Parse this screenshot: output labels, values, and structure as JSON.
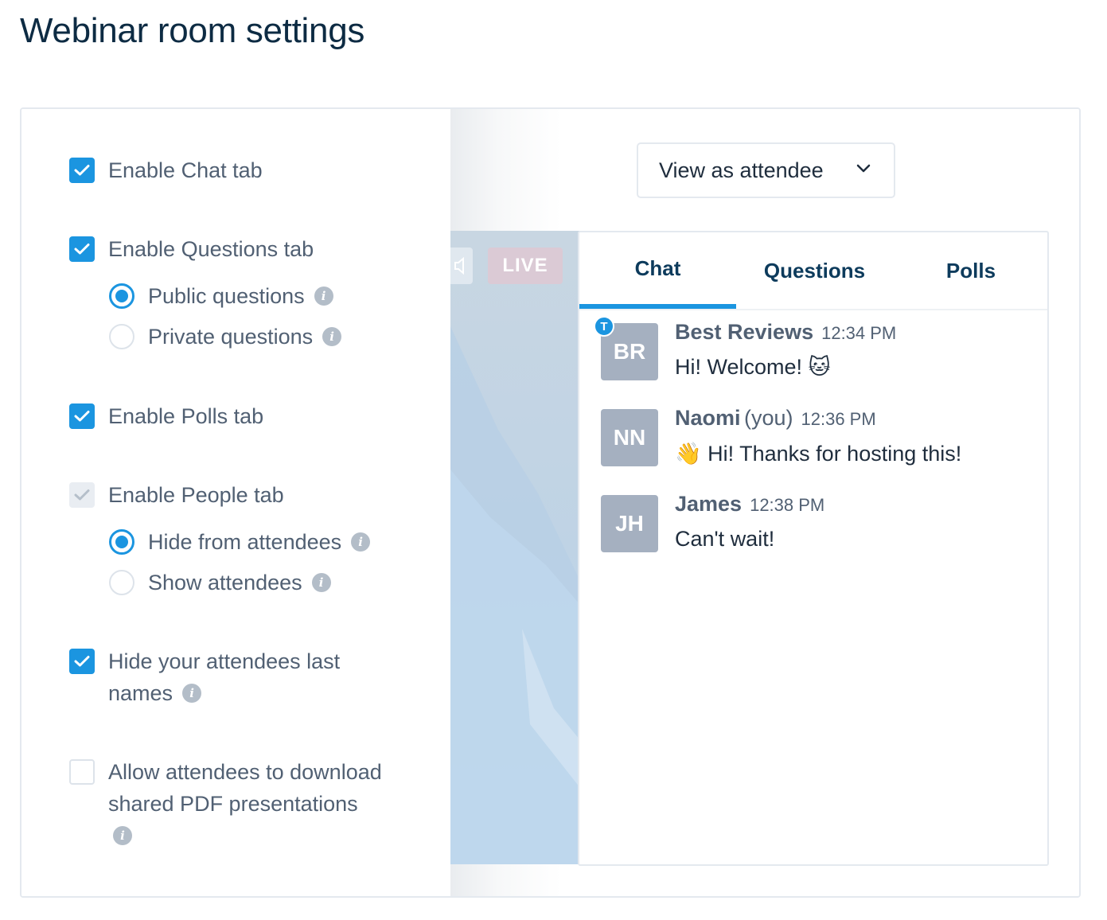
{
  "page": {
    "title": "Webinar room settings"
  },
  "settings": {
    "chat_tab": {
      "label": "Enable Chat tab",
      "checked": true
    },
    "questions_tab": {
      "label": "Enable Questions tab",
      "checked": true,
      "public": {
        "label": "Public questions",
        "selected": true
      },
      "private": {
        "label": "Private questions",
        "selected": false
      }
    },
    "polls_tab": {
      "label": "Enable Polls tab",
      "checked": true
    },
    "people_tab": {
      "label": "Enable People tab",
      "checked": true,
      "disabled": true,
      "hide": {
        "label": "Hide from attendees",
        "selected": true
      },
      "show": {
        "label": "Show attendees",
        "selected": false
      }
    },
    "hide_last_names": {
      "label_line1": "Hide your attendees last",
      "label_line2": "names",
      "checked": true
    },
    "allow_download": {
      "label_line1": "Allow attendees to download",
      "label_line2": "shared PDF presentations",
      "checked": false
    }
  },
  "preview": {
    "view_as": "View as attendee",
    "live_badge": "LIVE",
    "tabs": [
      {
        "label": "Chat",
        "active": true
      },
      {
        "label": "Questions",
        "active": false
      },
      {
        "label": "Polls",
        "active": false
      }
    ],
    "messages": [
      {
        "initials": "BR",
        "name": "Best Reviews",
        "you": "",
        "time": "12:34 PM",
        "text": "Hi! Welcome! 🐱",
        "host_badge": "T"
      },
      {
        "initials": "NN",
        "name": "Naomi",
        "you": "(you)",
        "time": "12:36 PM",
        "text": "👋 Hi! Thanks for hosting this!"
      },
      {
        "initials": "JH",
        "name": "James",
        "you": "",
        "time": "12:38 PM",
        "text": "Can't wait!"
      }
    ]
  },
  "colors": {
    "accent": "#1b95e0",
    "title": "#0d2b43",
    "avatar": "#a5b0c0"
  },
  "icons": {
    "info": "info-icon",
    "chevron": "chevron-down-icon",
    "check": "check-icon",
    "speaker": "speaker-icon"
  },
  "info_glyph": "i"
}
